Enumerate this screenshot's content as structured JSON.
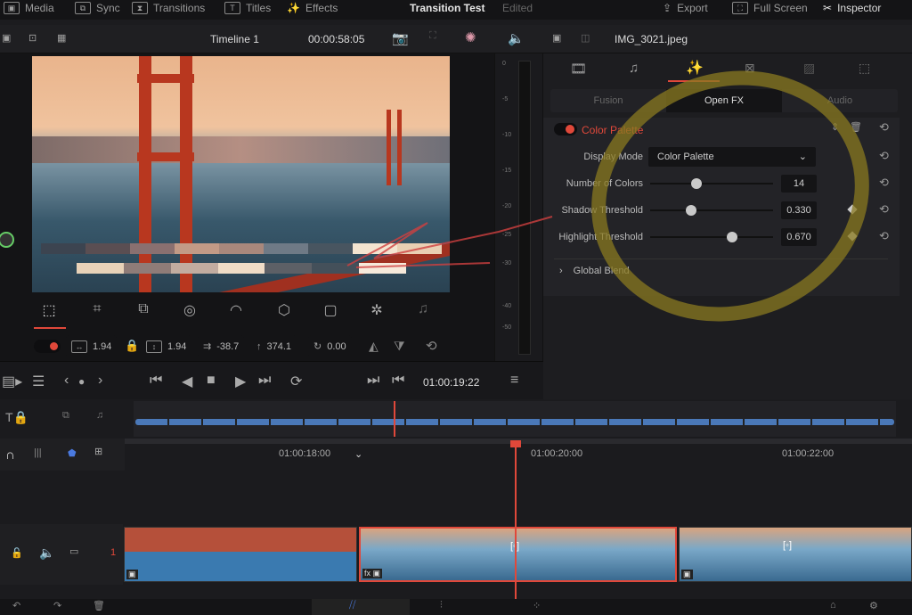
{
  "topbar": {
    "items": [
      {
        "label": "Media",
        "icon": "media-icon"
      },
      {
        "label": "Sync",
        "icon": "sync-icon"
      },
      {
        "label": "Transitions",
        "icon": "transitions-icon"
      },
      {
        "label": "Titles",
        "icon": "titles-icon"
      },
      {
        "label": "Effects",
        "icon": "effects-wand-icon"
      }
    ],
    "project_title": "Transition Test",
    "status": "Edited",
    "export": "Export",
    "fullscreen": "Full Screen",
    "inspector": "Inspector"
  },
  "viewer": {
    "timeline_name": "Timeline 1",
    "timecode": "00:00:58:05"
  },
  "transform": {
    "zoom_x": "1.94",
    "zoom_y": "1.94",
    "position_x": "-38.7",
    "position_y": "374.1",
    "rotation": "0.00"
  },
  "transport": {
    "timecode": "01:00:19:22"
  },
  "meter": {
    "scale": [
      "0",
      "-5",
      "-10",
      "-15",
      "-20",
      "-25",
      "-30",
      "-40",
      "-50"
    ]
  },
  "inspector": {
    "clip_name": "IMG_3021.jpeg",
    "subtabs": [
      "Fusion",
      "Open FX",
      "Audio"
    ],
    "active_subtab": "Open FX",
    "effect": {
      "name": "Color Palette",
      "enabled": true,
      "accent": "#e0483a",
      "display_mode_label": "Display Mode",
      "display_mode": "Color Palette",
      "params": [
        {
          "label": "Number of Colors",
          "value": "14",
          "fraction": 0.38
        },
        {
          "label": "Shadow Threshold",
          "value": "0.330",
          "fraction": 0.33
        },
        {
          "label": "Highlight Threshold",
          "value": "0.670",
          "fraction": 0.67
        }
      ],
      "global_blend": "Global Blend"
    }
  },
  "timeline": {
    "ruler": [
      "01:00:18:00",
      "01:00:20:00",
      "01:00:22:00"
    ],
    "track_number": "1"
  }
}
